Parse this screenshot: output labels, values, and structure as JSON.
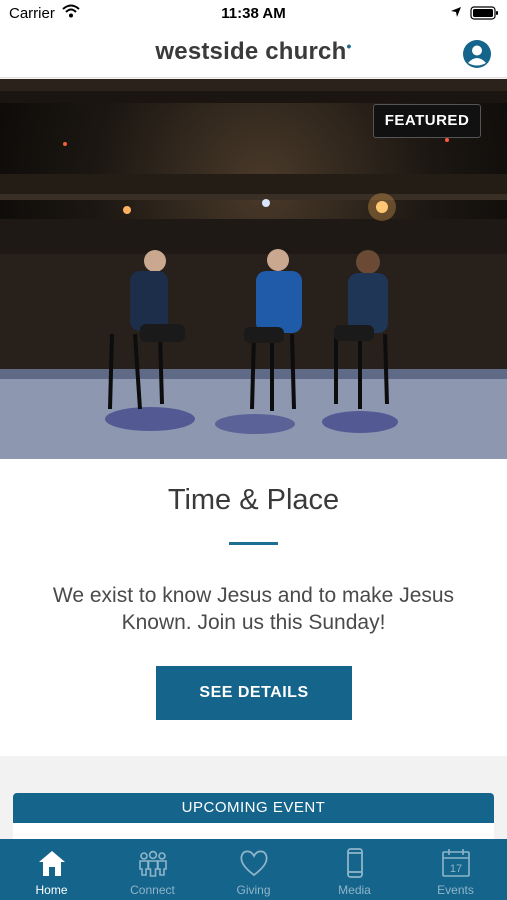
{
  "status_bar": {
    "carrier": "Carrier",
    "time": "11:38 AM"
  },
  "header": {
    "brand": "westside church",
    "brand_dot": "•"
  },
  "hero": {
    "badge": "FEATURED"
  },
  "feature": {
    "title": "Time & Place",
    "description": "We exist to know Jesus and to make Jesus Known. Join us this Sunday!",
    "button_label": "SEE DETAILS"
  },
  "upcoming": {
    "heading": "UPCOMING EVENT"
  },
  "tabs": [
    {
      "label": "Home",
      "icon": "home-icon",
      "active": true
    },
    {
      "label": "Connect",
      "icon": "people-icon",
      "active": false
    },
    {
      "label": "Giving",
      "icon": "heart-icon",
      "active": false
    },
    {
      "label": "Media",
      "icon": "phone-icon",
      "active": false
    },
    {
      "label": "Events",
      "icon": "calendar-icon",
      "active": false
    }
  ],
  "colors": {
    "brand_blue": "#15648b",
    "tab_inactive": "#8fb5c9"
  }
}
